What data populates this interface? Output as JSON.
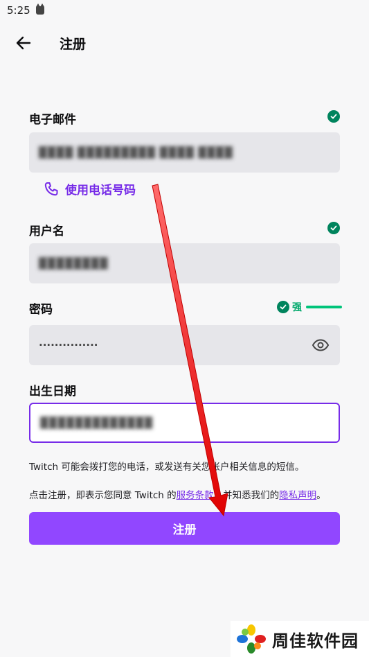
{
  "status_bar": {
    "time": "5:25"
  },
  "header": {
    "title": "注册"
  },
  "form": {
    "email": {
      "label": "电子邮件",
      "value": "████ █████████ ████ ████"
    },
    "phone_link": "使用电话号码",
    "username": {
      "label": "用户名",
      "value": "████████"
    },
    "password": {
      "label": "密码",
      "value": "···············",
      "strength": "强"
    },
    "birthday": {
      "label": "出生日期",
      "value": "█████████████"
    }
  },
  "notice": {
    "sms": "Twitch 可能会拨打您的电话，或发送有关您帐户相关信息的短信。",
    "terms_prefix": "点击注册，即表示您同意 Twitch 的",
    "terms_link": "服务条款",
    "terms_middle": "，并知悉我们的",
    "privacy_link": "隐私声明",
    "terms_suffix": "。"
  },
  "signup_button": "注册",
  "watermark": {
    "text": "周佳软件园"
  },
  "colors": {
    "accent": "#772ce8",
    "button": "#9147ff",
    "success": "#00845d",
    "annotation_arrow": "#e00000"
  }
}
